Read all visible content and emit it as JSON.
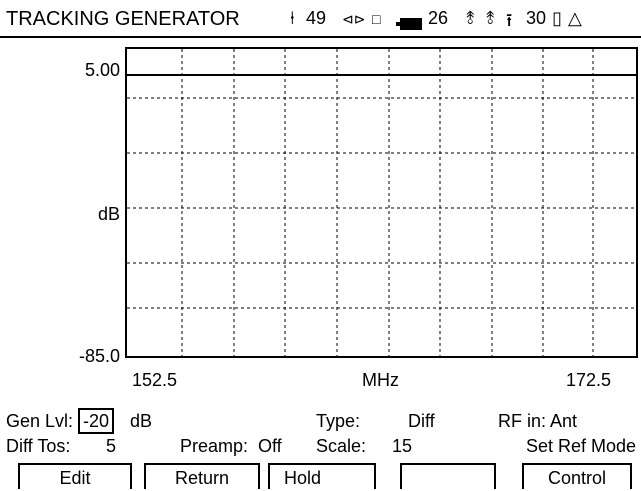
{
  "header": {
    "title": "TRACKING GENERATOR",
    "channel": "49",
    "temperature": "26",
    "time": "30"
  },
  "graph": {
    "y_top": "5.00",
    "y_unit": "dB",
    "y_bottom": "-85.0",
    "x_left": "152.5",
    "x_unit": "MHz",
    "x_right": "172.5"
  },
  "settings": {
    "gen_lvl_label": "Gen Lvl:",
    "gen_lvl_value": "-20",
    "gen_lvl_unit": "dB",
    "type_label": "Type:",
    "type_value": "Diff",
    "rf_in": "RF in: Ant",
    "diff_tos_label": "Diff Tos:",
    "diff_tos_value": "5",
    "preamp_label": "Preamp:",
    "preamp_value": "Off",
    "scale_label": "Scale:",
    "scale_value": "15",
    "set_ref_mode": "Set Ref Mode"
  },
  "softkeys": [
    "Edit",
    "Return",
    "Hold",
    "",
    "Control"
  ],
  "icons": [
    "antenna-icon",
    "cable-icon",
    "square-icon",
    "battery-icon",
    "up-arrow-icon",
    "up-arrow-icon",
    "up-arrow-icon",
    "rectangle-icon",
    "triangle-icon"
  ]
}
